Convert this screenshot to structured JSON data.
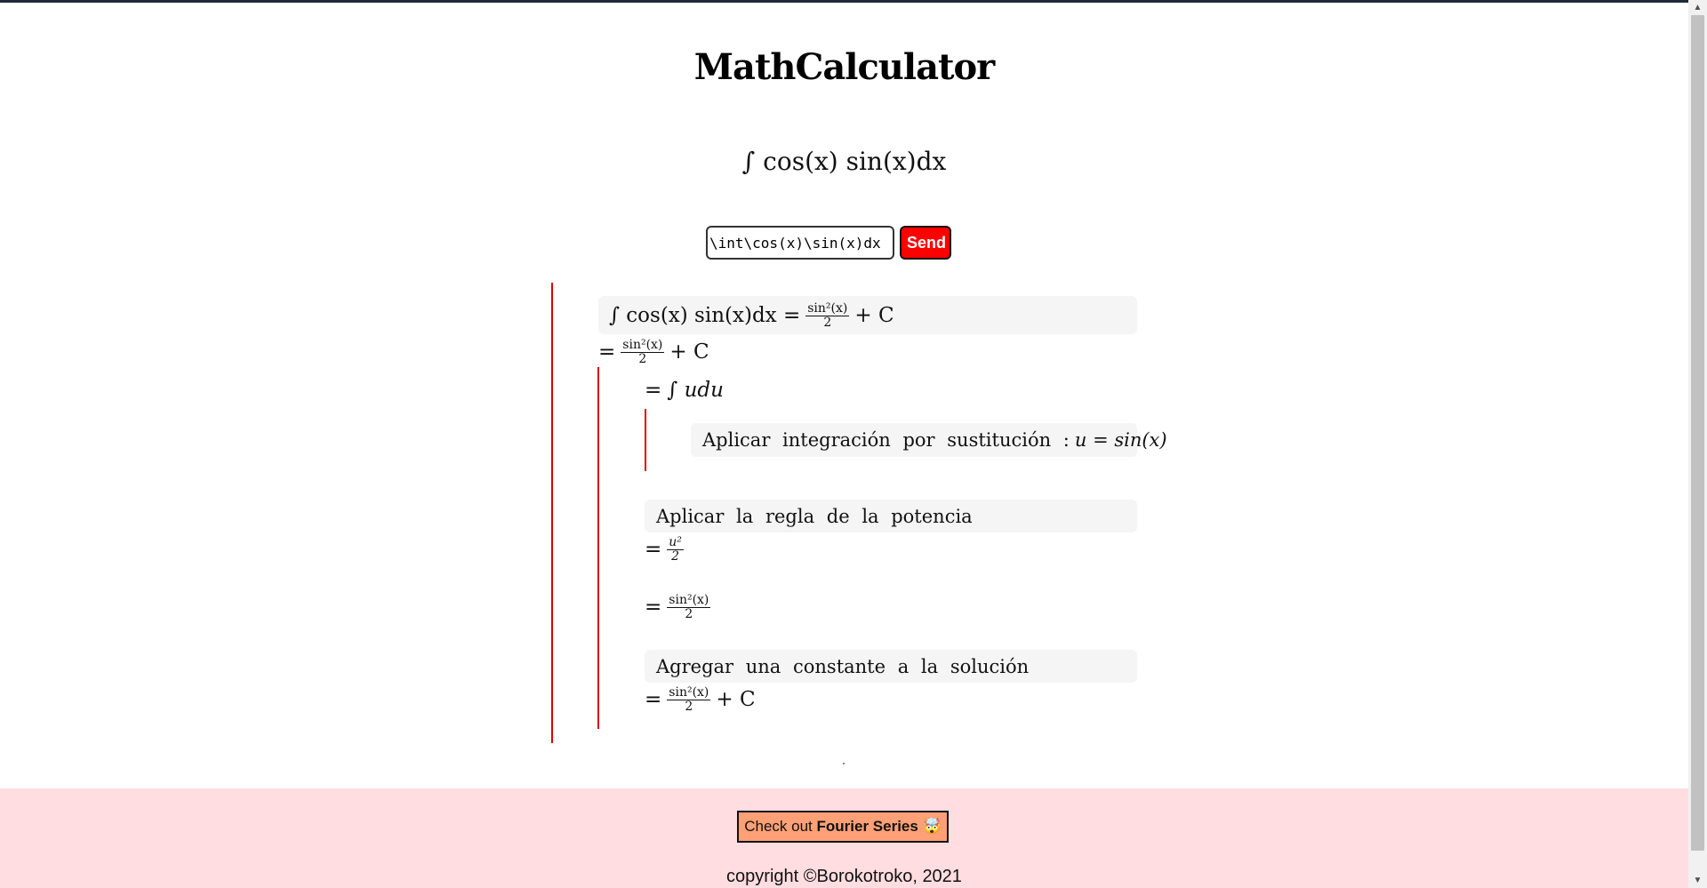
{
  "app": {
    "title": "MathCalculator"
  },
  "preview": {
    "expression": "∫ cos(x) sin(x)dx"
  },
  "form": {
    "input_value": "\\int\\cos(x)\\sin(x)dx",
    "send_label": "Send"
  },
  "solution": {
    "header": {
      "lhs": "∫  cos(x) sin(x)dx =",
      "frac_num": "sin²(x)",
      "frac_den": "2",
      "rhs": "+ C"
    },
    "result": {
      "eq": "=",
      "frac_num": "sin²(x)",
      "frac_den": "2",
      "rhs": "+ C"
    },
    "step_u_du": {
      "eq": "=",
      "expr": "∫ udu"
    },
    "substitution_text": "Aplicar integración por sustitución :",
    "substitution_expr": "u = sin(x)",
    "power_rule_text": "Aplicar la regla de la potencia",
    "power_result": {
      "eq": "=",
      "frac_num": "u²",
      "frac_den": "2"
    },
    "back_sub": {
      "eq": "=",
      "frac_num": "sin²(x)",
      "frac_den": "2"
    },
    "constant_text": "Agregar una constante a la solución",
    "final": {
      "eq": "=",
      "frac_num": "sin²(x)",
      "frac_den": "2",
      "rhs": "+ C"
    }
  },
  "footer": {
    "button_prefix": "Check out",
    "button_bold": "Fourier Series",
    "button_emoji": "🤯",
    "copyright": "copyright ©Borokotroko, 2021"
  },
  "colors": {
    "accent": "#ff0000",
    "footer_bg": "#ffdde1",
    "button_bg": "#ffa076"
  }
}
